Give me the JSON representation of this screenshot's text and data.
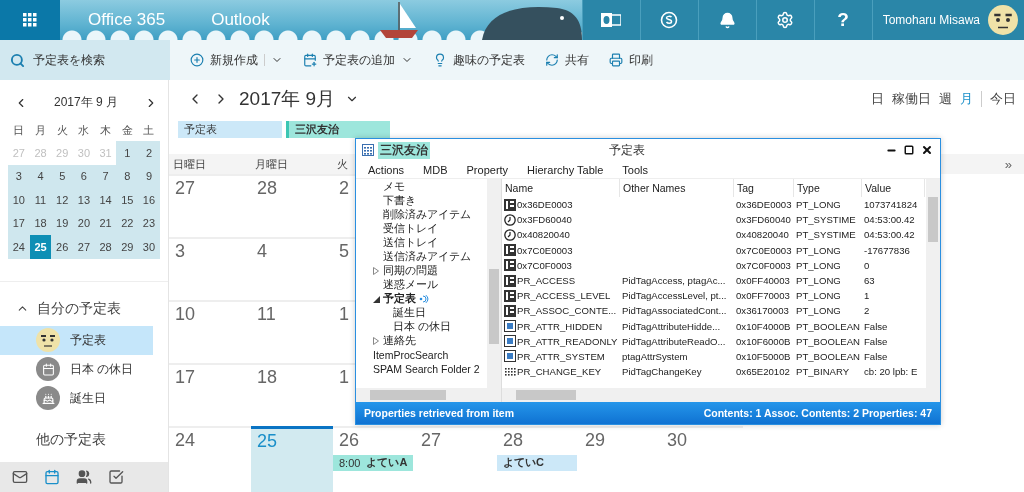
{
  "top_bar": {
    "brand": [
      "Office 365",
      "Outlook"
    ],
    "icons": [
      {
        "kind": "outlook"
      },
      {
        "kind": "skype"
      },
      {
        "kind": "bell"
      },
      {
        "kind": "settings"
      },
      {
        "kind": "help",
        "glyph": "?"
      }
    ],
    "user_name": "Tomoharu Misawa"
  },
  "search": {
    "label": "予定表を検索"
  },
  "toolbar": [
    {
      "kind": "new",
      "label": "新規作成",
      "split": true
    },
    {
      "kind": "add",
      "label": "予定表の追加",
      "split": false,
      "dropdown": true
    },
    {
      "kind": "interest",
      "label": "趣味の予定表"
    },
    {
      "kind": "share",
      "label": "共有"
    },
    {
      "kind": "print",
      "label": "印刷"
    }
  ],
  "mini_calendar": {
    "title": "2017年 9 月",
    "weekdays": [
      "日",
      "月",
      "火",
      "水",
      "木",
      "金",
      "土"
    ],
    "days": [
      {
        "label": "27",
        "other_month": true,
        "selected": false
      },
      {
        "label": "28",
        "other_month": true,
        "selected": false
      },
      {
        "label": "29",
        "other_month": true,
        "selected": false
      },
      {
        "label": "30",
        "other_month": true,
        "selected": false
      },
      {
        "label": "31",
        "other_month": true,
        "selected": false
      },
      {
        "label": "1",
        "other_month": false,
        "selected": false
      },
      {
        "label": "2",
        "other_month": false,
        "selected": false
      },
      {
        "label": "3",
        "other_month": false,
        "selected": false
      },
      {
        "label": "4",
        "other_month": false,
        "selected": false
      },
      {
        "label": "5",
        "other_month": false,
        "selected": false
      },
      {
        "label": "6",
        "other_month": false,
        "selected": false
      },
      {
        "label": "7",
        "other_month": false,
        "selected": false
      },
      {
        "label": "8",
        "other_month": false,
        "selected": false
      },
      {
        "label": "9",
        "other_month": false,
        "selected": false
      },
      {
        "label": "10",
        "other_month": false,
        "selected": false
      },
      {
        "label": "11",
        "other_month": false,
        "selected": false
      },
      {
        "label": "12",
        "other_month": false,
        "selected": false
      },
      {
        "label": "13",
        "other_month": false,
        "selected": false
      },
      {
        "label": "14",
        "other_month": false,
        "selected": false
      },
      {
        "label": "15",
        "other_month": false,
        "selected": false
      },
      {
        "label": "16",
        "other_month": false,
        "selected": false
      },
      {
        "label": "17",
        "other_month": false,
        "selected": false
      },
      {
        "label": "18",
        "other_month": false,
        "selected": false
      },
      {
        "label": "19",
        "other_month": false,
        "selected": false
      },
      {
        "label": "20",
        "other_month": false,
        "selected": false
      },
      {
        "label": "21",
        "other_month": false,
        "selected": false
      },
      {
        "label": "22",
        "other_month": false,
        "selected": false
      },
      {
        "label": "23",
        "other_month": false,
        "selected": false
      },
      {
        "label": "24",
        "other_month": false,
        "selected": false
      },
      {
        "label": "25",
        "other_month": false,
        "selected": true
      },
      {
        "label": "26",
        "other_month": false,
        "selected": false
      },
      {
        "label": "27",
        "other_month": false,
        "selected": false
      },
      {
        "label": "28",
        "other_month": false,
        "selected": false
      },
      {
        "label": "29",
        "other_month": false,
        "selected": false
      },
      {
        "label": "30",
        "other_month": false,
        "selected": false
      }
    ]
  },
  "my_calendars": {
    "title": "自分の予定表",
    "expanded": true,
    "items": [
      {
        "kind": "person",
        "label": "予定表",
        "selected": true
      },
      {
        "kind": "holiday",
        "label": "日本 の休日",
        "selected": false
      },
      {
        "kind": "birthday",
        "label": "誕生日",
        "selected": false
      }
    ]
  },
  "other_calendars": {
    "title": "他の予定表"
  },
  "bottom_nav": [
    {
      "kind": "mail",
      "selected": false
    },
    {
      "kind": "calendar",
      "selected": true
    },
    {
      "kind": "people",
      "selected": false
    },
    {
      "kind": "tasks",
      "selected": false
    }
  ],
  "calendar": {
    "title": "2017年 9月",
    "views": [
      {
        "label": "日",
        "selected": false
      },
      {
        "label": "稼働日",
        "selected": false
      },
      {
        "label": "週",
        "selected": false
      },
      {
        "label": "月",
        "selected": true
      }
    ],
    "today": "今日",
    "chips": [
      {
        "label": "予定表",
        "color": "#cce8f8",
        "selected": false
      },
      {
        "label": "三沢友治",
        "color": "#9de6dc",
        "selected": true
      }
    ],
    "weekdays": [
      "日曜日",
      "月曜日",
      "火"
    ],
    "more": "»",
    "weeks": [
      {
        "days": [
          {
            "label": "27",
            "selected": false
          },
          {
            "label": "28",
            "selected": false
          },
          {
            "label": "2",
            "selected": false
          }
        ]
      },
      {
        "days": [
          {
            "label": "3",
            "selected": false
          },
          {
            "label": "4",
            "selected": false
          },
          {
            "label": "5",
            "selected": false
          }
        ]
      },
      {
        "days": [
          {
            "label": "10",
            "selected": false
          },
          {
            "label": "11",
            "selected": false
          },
          {
            "label": "1",
            "selected": false
          }
        ]
      },
      {
        "days": [
          {
            "label": "17",
            "selected": false
          },
          {
            "label": "18",
            "selected": false
          },
          {
            "label": "1",
            "selected": false
          }
        ]
      },
      {
        "days": [
          {
            "label": "24",
            "selected": false
          },
          {
            "label": "25",
            "selected": true
          },
          {
            "label": "26",
            "selected": false,
            "events": [
              {
                "time": "8:00",
                "title": "よていA",
                "color": "#9de6dc"
              }
            ]
          },
          {
            "label": "27",
            "selected": false
          },
          {
            "label": "28",
            "selected": false,
            "events": [
              {
                "title": "よていC",
                "color": "#cce8f8"
              }
            ]
          },
          {
            "label": "29",
            "selected": false
          },
          {
            "label": "30",
            "selected": false
          }
        ]
      }
    ]
  },
  "mapi_window": {
    "owner": "三沢友治",
    "title": "予定表",
    "menu": [
      "Actions",
      "MDB",
      "Property",
      "Hierarchy Table",
      "Tools"
    ],
    "folders": [
      {
        "children": [
          {
            "label": "メモ",
            "selected": false
          },
          {
            "label": "下書き",
            "selected": false
          },
          {
            "label": "削除済みアイテム",
            "selected": false
          },
          {
            "label": "受信トレイ",
            "selected": false
          },
          {
            "label": "送信トレイ",
            "selected": false
          },
          {
            "label": "送信済みアイテム",
            "selected": false
          },
          {
            "label": "同期の問題",
            "expanded": false,
            "selected": false
          },
          {
            "label": "迷惑メール",
            "selected": false
          },
          {
            "label": "予定表",
            "expanded": true,
            "selected": true,
            "children": [
              {
                "label": "誕生日",
                "selected": false
              },
              {
                "label": "日本 の休日",
                "selected": false
              }
            ]
          },
          {
            "label": "連絡先",
            "expanded": false,
            "selected": false
          }
        ]
      },
      {
        "label": "ItemProcSearch",
        "selected": false
      },
      {
        "label": "SPAM Search Folder 2",
        "selected": false
      }
    ],
    "columns": [
      "Name",
      "Other Names",
      "Tag",
      "Type",
      "Value"
    ],
    "rows": [
      {
        "kind": "long",
        "name": "0x36DE0003",
        "tag": "0x36DE0003",
        "type": "PT_LONG",
        "value": "1073741824"
      },
      {
        "kind": "time",
        "name": "0x3FD60040",
        "tag": "0x3FD60040",
        "type": "PT_SYSTIME",
        "value": "04:53:00.42"
      },
      {
        "kind": "time",
        "name": "0x40820040",
        "tag": "0x40820040",
        "type": "PT_SYSTIME",
        "value": "04:53:00.42"
      },
      {
        "kind": "long",
        "name": "0x7C0E0003",
        "tag": "0x7C0E0003",
        "type": "PT_LONG",
        "value": "-17677836"
      },
      {
        "kind": "long",
        "name": "0x7C0F0003",
        "tag": "0x7C0F0003",
        "type": "PT_LONG",
        "value": "0"
      },
      {
        "kind": "long",
        "name": "PR_ACCESS",
        "other": "PidTagAccess, ptagAc...",
        "tag": "0x0FF40003",
        "type": "PT_LONG",
        "value": "63"
      },
      {
        "kind": "long",
        "name": "PR_ACCESS_LEVEL",
        "other": "PidTagAccessLevel, pt...",
        "tag": "0x0FF70003",
        "type": "PT_LONG",
        "value": "1"
      },
      {
        "kind": "long",
        "name": "PR_ASSOC_CONTE...",
        "other": "PidTagAssociatedCont...",
        "tag": "0x36170003",
        "type": "PT_LONG",
        "value": "2"
      },
      {
        "kind": "bool",
        "name": "PR_ATTR_HIDDEN",
        "other": "PidTagAttributeHidde...",
        "tag": "0x10F4000B",
        "type": "PT_BOOLEAN",
        "value": "False"
      },
      {
        "kind": "bool",
        "name": "PR_ATTR_READONLY",
        "other": "PidTagAttributeReadO...",
        "tag": "0x10F6000B",
        "type": "PT_BOOLEAN",
        "value": "False"
      },
      {
        "kind": "bool",
        "name": "PR_ATTR_SYSTEM",
        "other": "ptagAttrSystem",
        "tag": "0x10F5000B",
        "type": "PT_BOOLEAN",
        "value": "False"
      },
      {
        "kind": "binary",
        "name": "PR_CHANGE_KEY",
        "other": "PidTagChangeKey",
        "tag": "0x65E20102",
        "type": "PT_BINARY",
        "value": "cb: 20 lpb: E"
      }
    ],
    "status_left": "Properties retrieved from item",
    "status_right": "Contents: 1 Assoc. Contents: 2 Properties: 47"
  }
}
